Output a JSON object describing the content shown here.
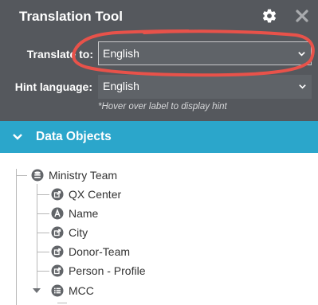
{
  "header": {
    "title": "Translation Tool",
    "icons": [
      "gear-icon",
      "close-icon"
    ]
  },
  "form": {
    "translate_to": {
      "label": "Translate to:",
      "value": "English"
    },
    "hint_language": {
      "label": "Hint language:",
      "value": "English"
    },
    "hint_note": "*Hover over label to display hint"
  },
  "data_objects": {
    "title": "Data Objects",
    "tree": {
      "root": {
        "label": "Ministry Team",
        "icon": "database-icon"
      },
      "children": [
        {
          "label": "QX Center",
          "icon": "link-icon"
        },
        {
          "label": "Name",
          "icon": "text-field-icon"
        },
        {
          "label": "City",
          "icon": "link-icon"
        },
        {
          "label": "Donor-Team",
          "icon": "link-icon"
        },
        {
          "label": "Person - Profile",
          "icon": "link-icon"
        },
        {
          "label": "MCC",
          "icon": "list-icon"
        }
      ]
    }
  },
  "colors": {
    "panel_bg": "#55585d",
    "accent_bar": "#2ba6cb",
    "annotation": "#e8524a"
  }
}
